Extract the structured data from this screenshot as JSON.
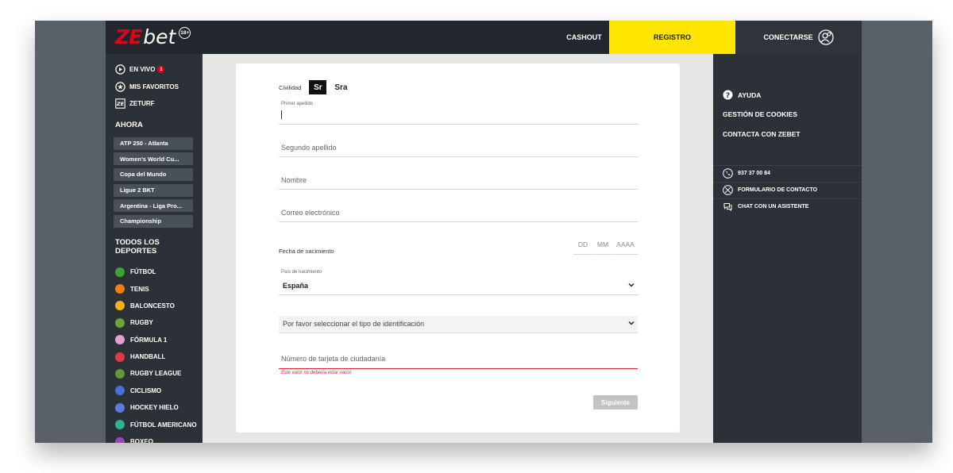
{
  "header": {
    "logo_ze": "ZE",
    "logo_bet": "bet",
    "age_badge": "18+",
    "nav_cashout": "CASHOUT",
    "nav_registro": "REGISTRO",
    "nav_conectarse": "CONECTARSE",
    "accent_color": "#ffe500",
    "brand_color": "#e2001a"
  },
  "sidebar_left": {
    "top_links": [
      {
        "label": "EN VIVO",
        "icon": "play-circle-icon",
        "badge": "1"
      },
      {
        "label": "MIS FAVORITOS",
        "icon": "star-circle-icon"
      },
      {
        "label": "ZETURF",
        "icon": "zeturf-logo-icon"
      }
    ],
    "ahora_title": "AHORA",
    "ahora_items": [
      "ATP 250 - Atlanta",
      "Women's World Cu...",
      "Copa del Mundo",
      "Ligue 2 BKT",
      "Argentina - Liga Pro...",
      "Championship"
    ],
    "todos_title": "TODOS LOS DEPORTES",
    "sports": [
      {
        "label": "FÚTBOL",
        "icon": "football-icon",
        "color": "#3aa335"
      },
      {
        "label": "TENIS",
        "icon": "tennis-icon",
        "color": "#f07c1c"
      },
      {
        "label": "BALONCESTO",
        "icon": "basketball-icon",
        "color": "#f1b21a"
      },
      {
        "label": "RUGBY",
        "icon": "rugby-icon",
        "color": "#6aa536"
      },
      {
        "label": "FÓRMULA 1",
        "icon": "formula1-icon",
        "color": "#e3a1d0"
      },
      {
        "label": "HANDBALL",
        "icon": "handball-icon",
        "color": "#e2394a"
      },
      {
        "label": "RUGBY LEAGUE",
        "icon": "rugby-league-icon",
        "color": "#5e9c33"
      },
      {
        "label": "CICLISMO",
        "icon": "cycling-icon",
        "color": "#4a6fd6"
      },
      {
        "label": "HOCKEY HIELO",
        "icon": "ice-hockey-icon",
        "color": "#5a7be0"
      },
      {
        "label": "FÚTBOL AMERICANO",
        "icon": "american-football-icon",
        "color": "#2fb38c"
      },
      {
        "label": "BOXEO",
        "icon": "boxing-icon",
        "color": "#a043c8"
      }
    ]
  },
  "form": {
    "civilidad_label": "Civilidad",
    "civ_sr": "Sr",
    "civ_sra": "Sra",
    "primer_apellido_label": "Primer apellido",
    "segundo_apellido_placeholder": "Segundo apellido",
    "nombre_placeholder": "Nombre",
    "correo_placeholder": "Correo electrónico",
    "fecha_label": "Fecha de nacimiento",
    "fecha_dd": "DD",
    "fecha_mm": "MM",
    "fecha_aaaa": "AAAA",
    "pais_label": "País de nacimiento",
    "pais_value": "España",
    "tipo_id_value": "Por favor seleccionar el tipo de identificación",
    "tarjeta_placeholder": "Número de tarjeta de ciudadanía",
    "error_text": "Este valor no debería estar vacío",
    "next_button": "Siguiente",
    "error_color": "#e0242c"
  },
  "sidebar_right": {
    "ayuda": "AYUDA",
    "cookies": "GESTIÓN DE COOKIES",
    "contacta": "CONTACTA CON ZEBET",
    "contacts": [
      {
        "label": "937 37 00 84",
        "icon": "phone-icon"
      },
      {
        "label": "FORMULARIO DE CONTACTO",
        "icon": "mail-form-icon"
      },
      {
        "label": "CHAT CON UN ASISTENTE",
        "icon": "chat-icon"
      }
    ]
  }
}
